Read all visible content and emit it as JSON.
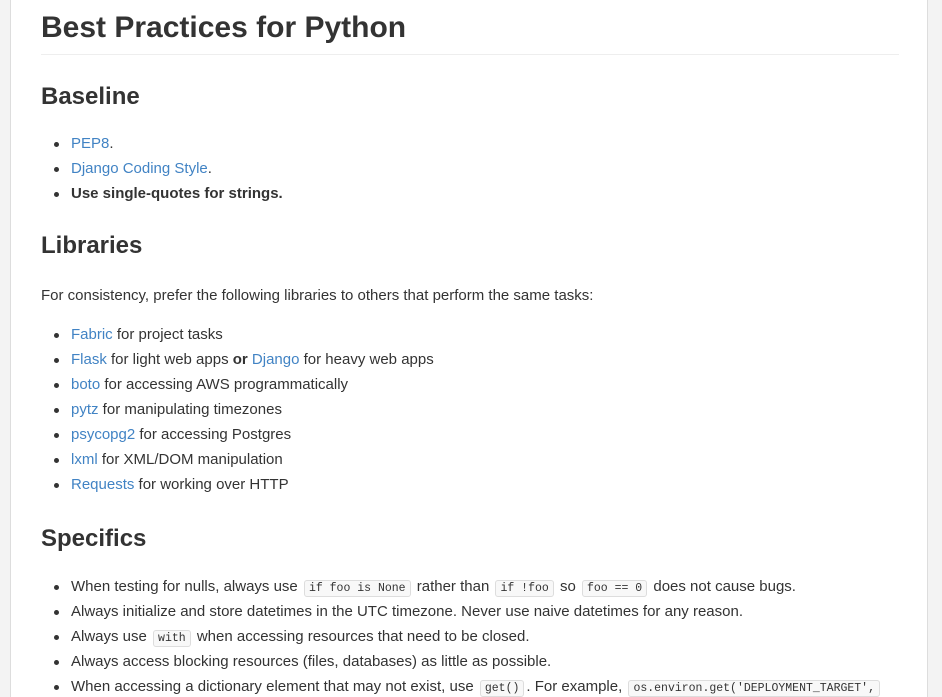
{
  "title": "Best Practices for Python",
  "baseline": {
    "heading": "Baseline",
    "items": {
      "pep8_link": "PEP8",
      "pep8_suffix": ".",
      "django_link": "Django Coding Style",
      "django_suffix": ".",
      "quotes": "Use single-quotes for strings."
    }
  },
  "libraries": {
    "heading": "Libraries",
    "intro": "For consistency, prefer the following libraries to others that perform the same tasks:",
    "fabric_link": "Fabric",
    "fabric_text": " for project tasks",
    "flask_link": "Flask",
    "flask_text": " for light web apps ",
    "flask_or": "or",
    "django_link": "Django",
    "django_text": " for heavy web apps",
    "boto_link": "boto",
    "boto_text": " for accessing AWS programmatically",
    "pytz_link": "pytz",
    "pytz_text": " for manipulating timezones",
    "psycopg2_link": "psycopg2",
    "psycopg2_text": " for accessing Postgres",
    "lxml_link": "lxml",
    "lxml_text": " for XML/DOM manipulation",
    "requests_link": "Requests",
    "requests_text": " for working over HTTP"
  },
  "specifics": {
    "heading": "Specifics",
    "nulls": {
      "t1": "When testing for nulls, always use ",
      "c1": "if foo is None",
      "t2": " rather than ",
      "c2": "if !foo",
      "t3": " so ",
      "c3": "foo == 0",
      "t4": " does not cause bugs."
    },
    "datetimes": "Always initialize and store datetimes in the UTC timezone. Never use naive datetimes for any reason.",
    "with": {
      "t1": "Always use ",
      "c1": "with",
      "t2": " when accessing resources that need to be closed."
    },
    "blocking": "Always access blocking resources (files, databases) as little as possible.",
    "dict": {
      "t1": "When accessing a dictionary element that may not exist, use ",
      "c1": "get()",
      "t2": ". For example, ",
      "c2": "os.environ.get('DEPLOYMENT_TARGET',"
    }
  }
}
